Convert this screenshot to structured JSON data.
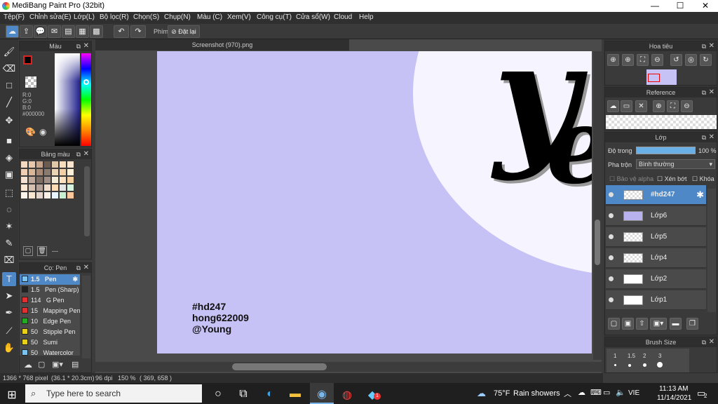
{
  "window": {
    "title": "MediBang Paint Pro (32bit)",
    "min": "—",
    "max": "☐",
    "close": "✕"
  },
  "menu": [
    "Tệp(F)",
    "Chỉnh sửa(E)",
    "Lớp(L)",
    "Bộ lọc(R)",
    "Chọn(S)",
    "Chụp(N)",
    "Màu (C)",
    "Xem(V)",
    "Công cụ(T)",
    "Cửa sổ(W)",
    "Cloud",
    "Help"
  ],
  "toolbar": {
    "shortcut_label": "Phím",
    "reset_label": "Đặt lại"
  },
  "color_panel": {
    "title": "Màu",
    "r": "R:0",
    "g": "G:0",
    "b": "B:0",
    "hex": "#000000"
  },
  "palette_panel": {
    "title": "Bảng màu",
    "footer": "---"
  },
  "brush_panel": {
    "title": "Cọ: Pen",
    "items": [
      {
        "size": "1.5",
        "name": "Pen",
        "color": "#7cc3f0"
      },
      {
        "size": "1.5",
        "name": "Pen (Sharp)",
        "color": "#222222"
      },
      {
        "size": "114",
        "name": "G Pen",
        "color": "#e03030"
      },
      {
        "size": "15",
        "name": "Mapping Pen",
        "color": "#e03030"
      },
      {
        "size": "10",
        "name": "Edge Pen",
        "color": "#22aa22"
      },
      {
        "size": "50",
        "name": "Stipple Pen",
        "color": "#e6d21a"
      },
      {
        "size": "50",
        "name": "Sumi",
        "color": "#e6d21a"
      },
      {
        "size": "50",
        "name": "Watercolor",
        "color": "#7cc3f0"
      }
    ]
  },
  "document": {
    "tab": "Screenshot (970).png",
    "caption": [
      "#hd247",
      "hong622009",
      "@Young"
    ]
  },
  "status": {
    "size": "1366 * 768 pixel",
    "cm": "(36.1 * 20.3cm)",
    "dpi": "96 dpi",
    "zoom": "150 %",
    "coords": "( 369, 658 )"
  },
  "navigator": {
    "title": "Hoa tiêu"
  },
  "reference": {
    "title": "Reference"
  },
  "layers": {
    "title": "Lớp",
    "opacity_label": "Độ trong",
    "opacity_value": "100 %",
    "blend_label": "Pha trộn",
    "blend_value": "Bình thường",
    "alpha_lock": "Bảo vệ alpha",
    "clip": "Xén bớt",
    "lock": "Khóa",
    "items": [
      "#hd247",
      "Lớp6",
      "Lớp5",
      "Lớp4",
      "Lớp2",
      "Lớp1"
    ]
  },
  "brush_size": {
    "title": "Brush Size",
    "values": [
      "1",
      "1.5",
      "2",
      "3"
    ]
  },
  "taskbar": {
    "search_placeholder": "Type here to search",
    "weather_temp": "75°F",
    "weather_text": "Rain showers",
    "lang": "VIE",
    "time": "11:13 AM",
    "date": "11/14/2021",
    "notif": "2",
    "badge": "1"
  }
}
